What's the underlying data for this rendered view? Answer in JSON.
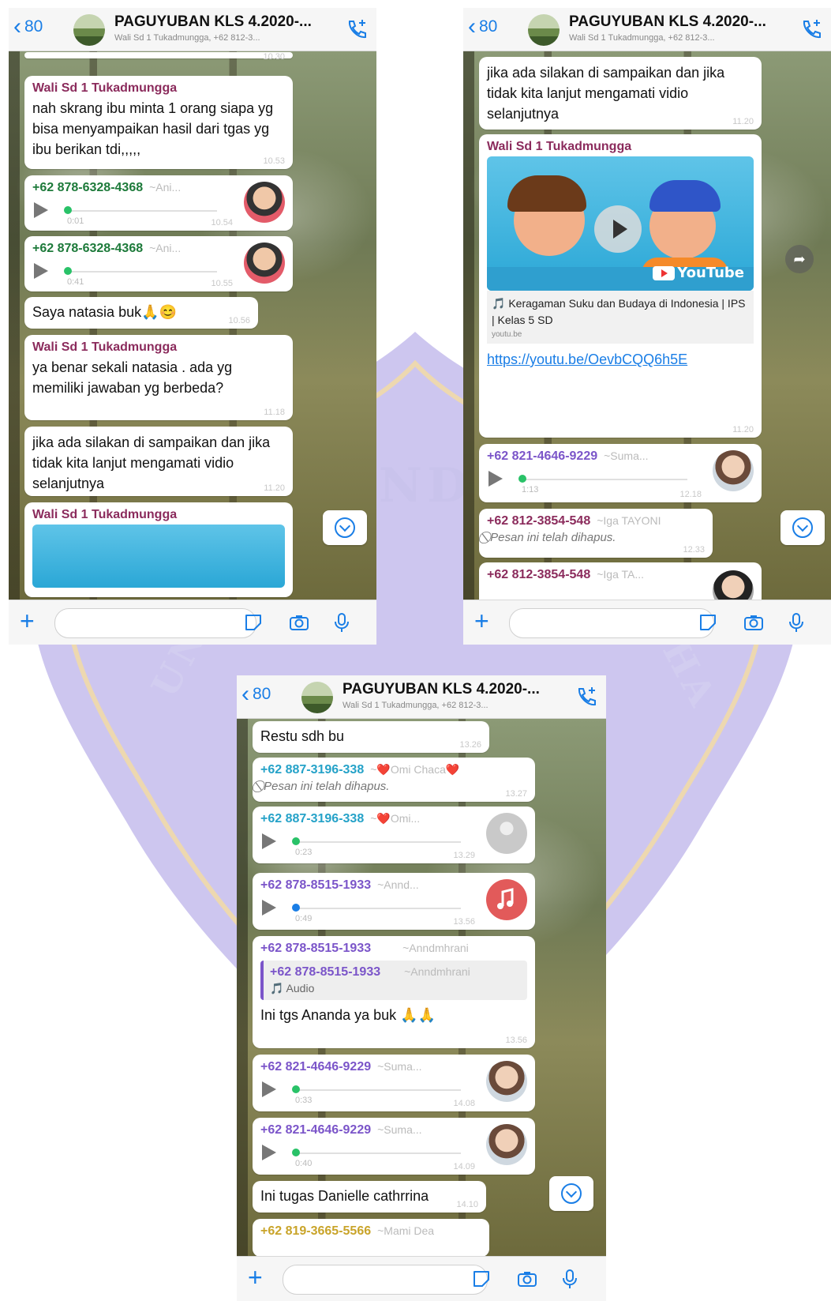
{
  "watermark": {
    "mid": "NDII",
    "left": "UN",
    "right": "SHA"
  },
  "colors": {
    "accent": "#1a7ee6",
    "voice_dot": "#29c268",
    "bubble": "#ffffff",
    "wali": "#8b2b5c",
    "green_sender": "#1d7a3a",
    "teal_sender": "#25a2c8",
    "purple_sender": "#7b55c9"
  },
  "screens": [
    {
      "header": {
        "back_count": "80",
        "title": "PAGUYUBAN KLS 4.2020-...",
        "subtitle": "Wali Sd 1 Tukadmungga, +62 812-3..."
      },
      "messages": {
        "m1": {
          "sender": "Wali Sd 1 Tukadmungga",
          "text": "nah skrang  ibu minta 1 orang siapa yg bisa menyampaikan hasil dari tgas yg ibu berikan tdi,,,,,",
          "time": "10.53"
        },
        "m2": {
          "sender": "+62 878-6328-4368",
          "alias": "~Ani...",
          "duration": "0:01",
          "time": "10.54"
        },
        "m3": {
          "sender": "+62 878-6328-4368",
          "alias": "~Ani...",
          "duration": "0:41",
          "time": "10.55"
        },
        "m4": {
          "text": "Saya natasia buk🙏😊",
          "time": "10.56"
        },
        "m5": {
          "sender": "Wali Sd 1 Tukadmungga",
          "text": "ya benar sekali natasia . ada yg memiliki jawaban yg berbeda?",
          "time": "11.18"
        },
        "m6": {
          "text": "jika ada silakan di sampaikan dan jika tidak kita lanjut mengamati vidio selanjutnya",
          "time": "11.20"
        },
        "m7": {
          "sender": "Wali Sd 1 Tukadmungga"
        }
      },
      "top_time": "10.30"
    },
    {
      "header": {
        "back_count": "80",
        "title": "PAGUYUBAN KLS 4.2020-...",
        "subtitle": "Wali Sd 1 Tukadmungga, +62 812-3..."
      },
      "messages": {
        "m1": {
          "text": "jika ada silakan di sampaikan dan jika tidak kita lanjut mengamati vidio selanjutnya",
          "time": "11.20"
        },
        "m2": {
          "sender": "Wali Sd 1 Tukadmungga",
          "yt_label": "YouTube",
          "yt_title": "🎵 Keragaman Suku dan Budaya di Indonesia | IPS | Kelas 5 SD",
          "yt_host": "youtu.be",
          "link": "https://youtu.be/OevbCQQ6h5E",
          "time": "11.20"
        },
        "m3": {
          "sender": "+62 821-4646-9229",
          "alias": "~Suma...",
          "duration": "1:13",
          "time": "12.18"
        },
        "m4": {
          "sender": "+62 812-3854-548",
          "alias": "~Iga TAYONI",
          "deleted": "⃠ Pesan ini telah dihapus.",
          "time": "12.33"
        },
        "m5": {
          "sender": "+62 812-3854-548",
          "alias": "~Iga TA..."
        }
      }
    },
    {
      "header": {
        "back_count": "80",
        "title": "PAGUYUBAN KLS 4.2020-...",
        "subtitle": "Wali Sd 1 Tukadmungga, +62 812-3..."
      },
      "messages": {
        "m1": {
          "text": "Restu sdh bu",
          "time": "13.26"
        },
        "m2": {
          "sender": "+62 887-3196-338",
          "alias": "~❤️Omi Chaca❤️",
          "deleted": "⃠ Pesan ini telah dihapus.",
          "time": "13.27"
        },
        "m3": {
          "sender": "+62 887-3196-338",
          "alias": "~❤️Omi...",
          "duration": "0:23",
          "time": "13.29"
        },
        "m4": {
          "sender": "+62 878-8515-1933",
          "alias": "~Annd...",
          "duration": "0:49",
          "time": "13.56"
        },
        "m5": {
          "sender": "+62 878-8515-1933",
          "alias": "~Anndmhrani",
          "quote_sender": "+62 878-8515-1933",
          "quote_alias": "~Anndmhrani",
          "quote_text": "🎵 Audio",
          "text": "Ini tgs Ananda ya buk 🙏🙏",
          "time": "13.56"
        },
        "m6": {
          "sender": "+62 821-4646-9229",
          "alias": "~Suma...",
          "duration": "0:33",
          "time": "14.08"
        },
        "m7": {
          "sender": "+62 821-4646-9229",
          "alias": "~Suma...",
          "duration": "0:40",
          "time": "14.09"
        },
        "m8": {
          "text": "Ini tugas Danielle cathrrina",
          "time": "14.10"
        },
        "m9": {
          "sender": "+62 819-3665-5566",
          "alias": "~Mami Dea"
        }
      }
    }
  ]
}
